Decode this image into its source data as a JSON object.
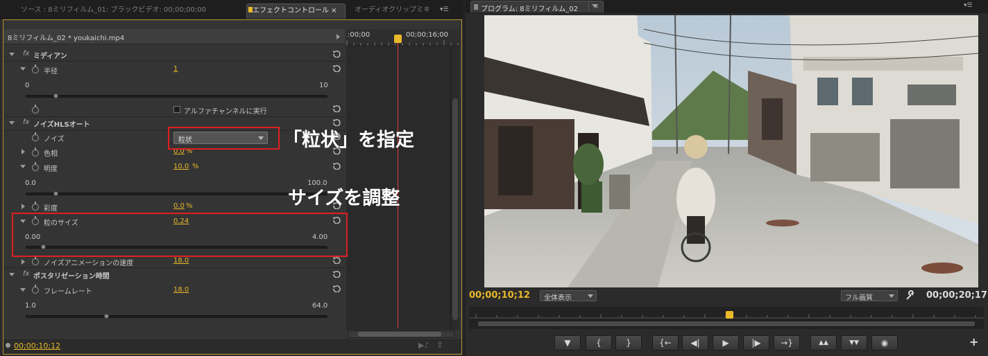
{
  "left_panel": {
    "tabs": [
      {
        "label": "ソース : 8ミリフィルム_01: ブラックビデオ: 00;00;00;00"
      },
      {
        "label": "エフェクトコントロール ×"
      },
      {
        "label": "オーディオクリップミキ"
      }
    ],
    "clip_name": "8ミリフィルム_02 * youkaichi.mp4",
    "ruler": {
      "start": ":00;00",
      "end": "00;00;16;00"
    },
    "effects": {
      "median": {
        "title": "ミディアン",
        "radius_label": "半径",
        "radius_value": "1",
        "radius_min": "0",
        "radius_max": "10",
        "radius_fraction": 0.1,
        "alpha_label": "アルファチャンネルに実行"
      },
      "noise_hls": {
        "title": "ノイズHLSオート",
        "noise_label": "ノイズ",
        "noise_selected": "粒状",
        "hue_label": "色相",
        "hue_value": "0.0",
        "percent": "%",
        "lightness_label": "明度",
        "lightness_value": "10.0",
        "lightness_min": "0.0",
        "lightness_max": "100.0",
        "lightness_fraction": 0.1,
        "saturation_label": "彩度",
        "saturation_value": "0.0",
        "grain_label": "粒のサイズ",
        "grain_value": "0.24",
        "grain_min": "0.00",
        "grain_max": "4.00",
        "grain_fraction": 0.06,
        "anim_speed_label": "ノイズアニメーションの速度",
        "anim_speed_value": "18.0"
      },
      "posterize_time": {
        "title": "ポスタリゼーション時間",
        "frame_rate_label": "フレームレート",
        "frame_rate_value": "18.0",
        "frame_rate_min": "1.0",
        "frame_rate_max": "64.0",
        "frame_rate_fraction": 0.27
      }
    },
    "fx_label": "fx",
    "current_time": "00;00;10;12"
  },
  "annotations": {
    "grain_type": "「粒状」を指定",
    "size_adjust": "サイズを調整"
  },
  "right_panel": {
    "tab_label": "プログラム: 8ミリフィルム_02",
    "current_time": "00;00;10;12",
    "zoom_select": "全体表示",
    "quality_select": "フル画質",
    "duration": "00;00;20;17",
    "transport_buttons": [
      "▼",
      "{",
      "}",
      "{←",
      "◀|",
      "▶",
      "|▶",
      "→}",
      "▲▲",
      "▼▼",
      "◉"
    ],
    "add_button": "+"
  },
  "colors": {
    "accent": "#e8b92a",
    "annotation_box": "#e0201f",
    "playhead": "#e23a3a"
  }
}
